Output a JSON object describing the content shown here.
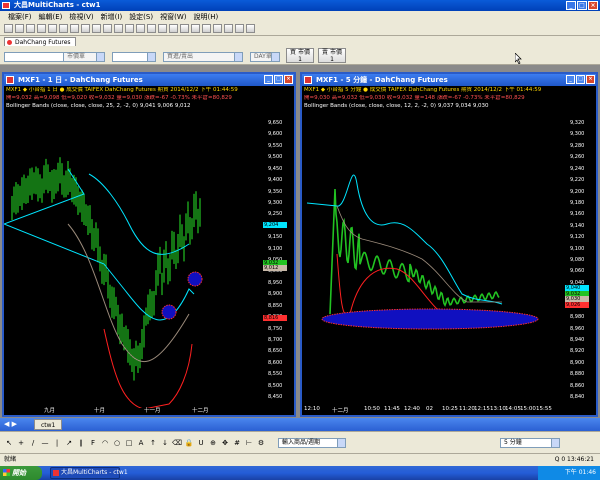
{
  "app": {
    "title": "大昌MultiCharts - ctw1"
  },
  "menu": [
    "檔案(F)",
    "編輯(E)",
    "檢視(V)",
    "新增(I)",
    "設定(S)",
    "視窗(W)",
    "說明(H)"
  ],
  "toolbar2": {
    "tab_label": "DahChang Futures",
    "field_market": "市價單",
    "field_order": "買進/賣出",
    "field_day": "DAY單",
    "btn_buy_label": "買 市價",
    "btn_buy_qty": "1",
    "btn_sell_label": "賣 市價",
    "btn_sell_qty": "1"
  },
  "left_chart": {
    "title": "MXF1 - 1 日 - DahChang Futures",
    "line1": "MXF1 ◆ 小台指 1 日 ● 成交價 TAIFEX DahChang Futures 期貨 2014/12/2 下午 01:44:59",
    "line2": "開=9,032 高=9,098 低=9,020 收=9,032 量=9,030 漲跌=-67 -0.73% 未平倉=80,829",
    "line3": "Bollinger Bands (close, close, close, 25, 2, -2, 0) 9,041 9,006 9,012",
    "y_ticks": [
      "9,650",
      "9,600",
      "9,550",
      "9,500",
      "9,450",
      "9,400",
      "9,350",
      "9,300",
      "9,250",
      "9,200",
      "9,150",
      "9,100",
      "9,050",
      "9,000",
      "8,950",
      "8,900",
      "8,850",
      "8,800",
      "8,750",
      "8,700",
      "8,650",
      "8,600",
      "8,550",
      "8,500",
      "8,450"
    ],
    "labels": {
      "upper": "9,204",
      "close": "9,032",
      "mid": "9,012",
      "lower": "8,816"
    },
    "x_labels": [
      "九月",
      "十月",
      "十一月",
      "十二月"
    ]
  },
  "right_chart": {
    "title": "MXF1 - 5 分鐘 - DahChang Futures",
    "line1": "MXF1 ◆ 小台指 5 分鐘 ● 成交價 TAIFEX DahChang Futures 期貨 2014/12/2 下午 01:44:59",
    "line2": "開=9,030 高=9,032 低=9,030 收=9,032 量=148 漲跌=-67 -0.73% 未平倉=80,829",
    "line3": "Bollinger Bands (close, close, close, 12, 2, -2, 0) 9,037 9,034 9,030",
    "y_ticks": [
      "9,320",
      "9,300",
      "9,280",
      "9,260",
      "9,240",
      "9,220",
      "9,200",
      "9,180",
      "9,160",
      "9,140",
      "9,120",
      "9,100",
      "9,080",
      "9,060",
      "9,040",
      "9,020",
      "9,000",
      "8,980",
      "8,960",
      "8,940",
      "8,920",
      "8,900",
      "8,880",
      "8,860",
      "8,840"
    ],
    "labels": {
      "upper": "9,040",
      "close": "9,032",
      "mid": "9,030",
      "lower": "9,026"
    },
    "x_labels": [
      "12:10",
      "十二月",
      "10:50",
      "11:45",
      "12:40",
      "02",
      "10:25",
      "11:20",
      "12:15",
      "13:10",
      "14:05",
      "15:00",
      "15:55"
    ]
  },
  "sheet": {
    "tab": "ctw1"
  },
  "drawbar": {
    "symbol_field": "輸入商品/週期",
    "interval": "5 分鐘"
  },
  "status": {
    "left": "就緒",
    "right": "Q   0   13:46:21"
  },
  "taskbar": {
    "start": "開始",
    "task": "大昌MultiCharts - ctw1",
    "clock": "下午 01:46"
  },
  "colors": {
    "upper_band": "#00e5ff",
    "lower_band": "#ff2020",
    "mid_band": "#9a8a7a",
    "candle": "#22c222",
    "ellipse": "#1010c0"
  }
}
